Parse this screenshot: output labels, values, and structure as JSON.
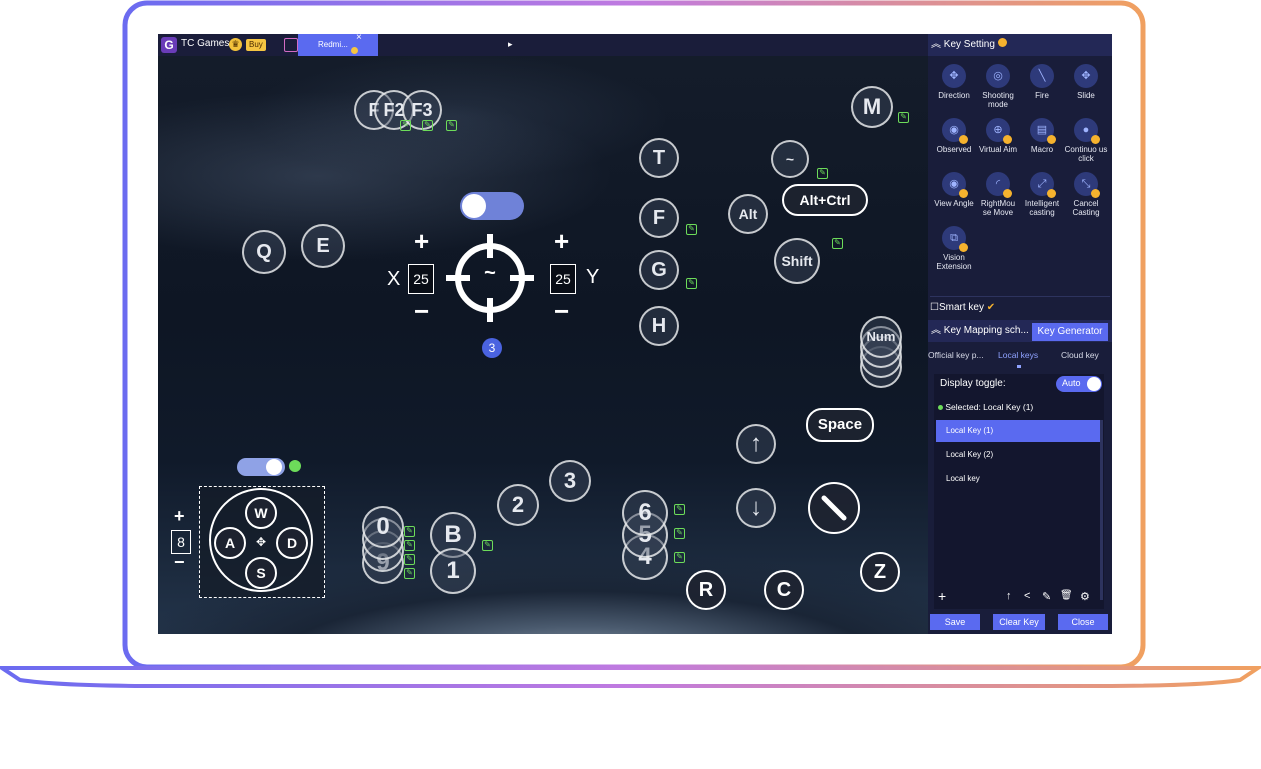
{
  "app": {
    "title": "TC Games",
    "logo_letter": "G",
    "buy_label": "Buy",
    "tab_label": "Redmi...",
    "tab_close": "×",
    "tab_arrow": "▸"
  },
  "game_keys": {
    "f_keys": [
      "F",
      "F2",
      "F3"
    ],
    "m": "M",
    "t": "T",
    "f": "F",
    "g": "G",
    "h": "H",
    "tilde": "~",
    "alt": "Alt",
    "alt_ctrl": "Alt+Ctrl",
    "shift": "Shift",
    "num": "Num",
    "q": "Q",
    "e": "E",
    "space": "Space",
    "up_arrow": "↑",
    "down_arrow": "↓",
    "z": "Z",
    "r": "R",
    "c": "C",
    "nums_stack_left": [
      "0",
      "9"
    ],
    "b": "B",
    "one": "1",
    "two": "2",
    "three": "3",
    "stack_right": [
      "6",
      "5",
      "4"
    ]
  },
  "aim": {
    "x_label": "X",
    "y_label": "Y",
    "x_value": "25",
    "y_value": "25",
    "plus": "+",
    "minus": "−",
    "center": "~",
    "badge": "3"
  },
  "wasd": {
    "w": "W",
    "a": "A",
    "s": "S",
    "d": "D",
    "size_value": "8",
    "plus": "+",
    "minus": "−"
  },
  "panel": {
    "header": "Key Setting",
    "icons": [
      {
        "label": "Direction",
        "icon": "direction-icon",
        "glyph": "✥"
      },
      {
        "label": "Shooting mode",
        "icon": "shooting-mode-icon",
        "glyph": "◎"
      },
      {
        "label": "Fire",
        "icon": "fire-icon",
        "glyph": "╲"
      },
      {
        "label": "Slide",
        "icon": "slide-icon",
        "glyph": "✥"
      },
      {
        "label": "Observed",
        "icon": "observed-icon",
        "glyph": "◉"
      },
      {
        "label": "Virtual Aim",
        "icon": "virtual-aim-icon",
        "glyph": "⊕"
      },
      {
        "label": "Macro",
        "icon": "macro-icon",
        "glyph": "▤"
      },
      {
        "label": "Continuo us click",
        "icon": "continuous-click-icon",
        "glyph": "●"
      },
      {
        "label": "View Angle",
        "icon": "view-angle-icon",
        "glyph": "◉"
      },
      {
        "label": "RightMou se Move",
        "icon": "right-mouse-move-icon",
        "glyph": "◜"
      },
      {
        "label": "Intelligent casting",
        "icon": "intelligent-casting-icon",
        "glyph": "⤢"
      },
      {
        "label": "Cancel Casting",
        "icon": "cancel-casting-icon",
        "glyph": "⤡"
      },
      {
        "label": "Vision Extension",
        "icon": "vision-extension-icon",
        "glyph": "⧉"
      }
    ],
    "smart_key": "Smart key",
    "mapping_header": "Key Mapping sch...",
    "key_generator": "Key Generator",
    "tabs": [
      "Official key p...",
      "Local keys",
      "Cloud key"
    ],
    "display_toggle": "Display toggle:",
    "auto": "Auto",
    "selected": "Selected: Local Key (1)",
    "keys_list": [
      "Local Key (1)",
      "Local Key (2)",
      "Local key"
    ],
    "list_tools": [
      "+",
      "↑",
      "<",
      "✎",
      "🗑",
      "⚙"
    ],
    "save": "Save",
    "clear_key": "Clear Key",
    "close": "Close"
  },
  "colors": {
    "accent": "#5a6af0",
    "panel_bg": "#191d3a",
    "edit_green": "#6ddc5a",
    "lock_gold": "#f5b22e"
  }
}
